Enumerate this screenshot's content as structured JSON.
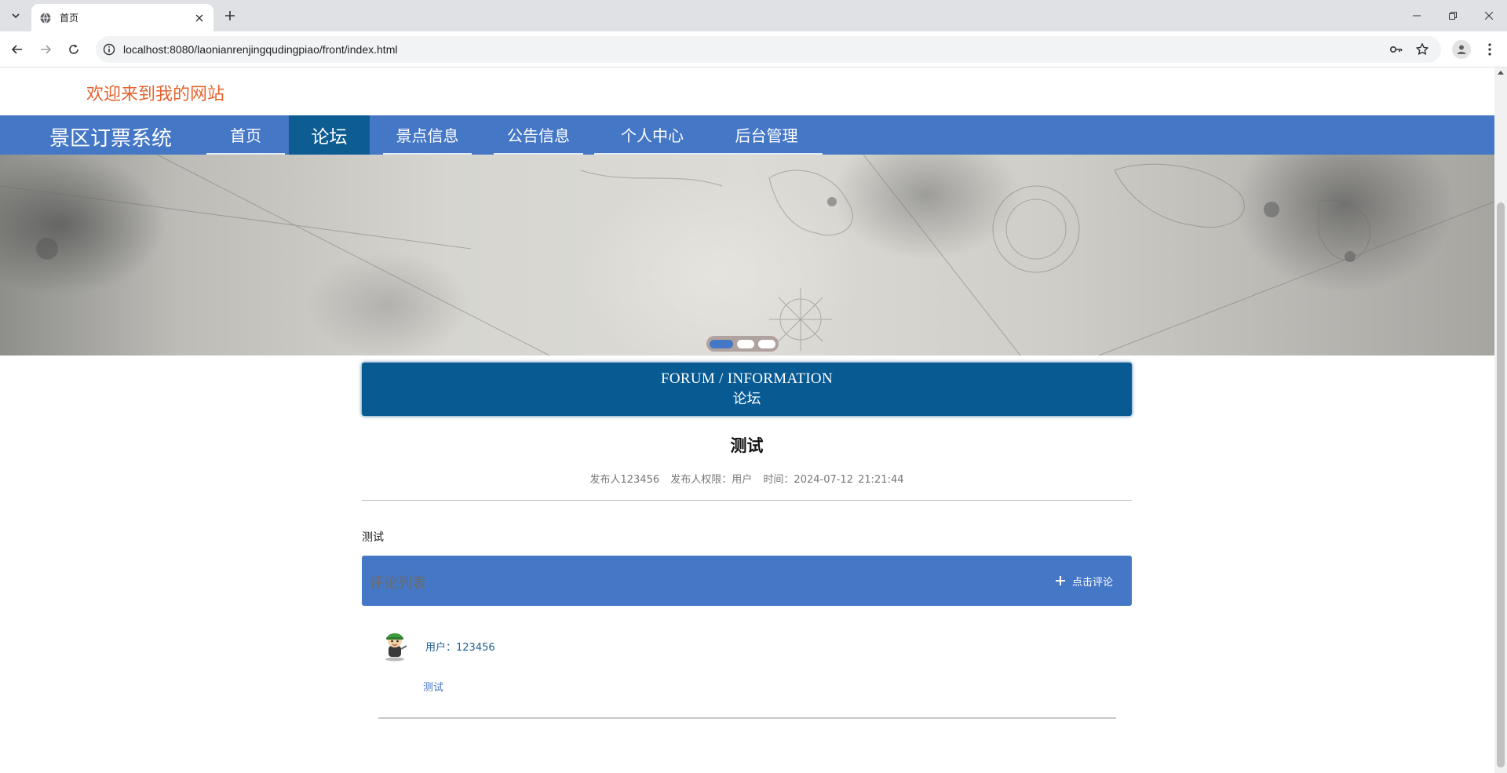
{
  "browser": {
    "tab_title": "首页",
    "url": "localhost:8080/laonianrenjingqudingpiao/front/index.html"
  },
  "site": {
    "welcome": "欢迎来到我的网站",
    "brand": "景区订票系统"
  },
  "nav": {
    "items": [
      {
        "label": "首页"
      },
      {
        "label": "论坛"
      },
      {
        "label": "景点信息"
      },
      {
        "label": "公告信息"
      },
      {
        "label": "个人中心"
      },
      {
        "label": "后台管理"
      }
    ],
    "active_index": 1
  },
  "carousel": {
    "slide_count": 3,
    "active_slide": 0
  },
  "section": {
    "title_en": "FORUM / INFORMATION",
    "title_zh": "论坛"
  },
  "post": {
    "title": "测试",
    "author": "发布人123456",
    "role": "发布人权限：用户",
    "time": "时间：2024-07-12 21:21:44",
    "content": "测试"
  },
  "comments_section": {
    "title": "评论列表",
    "add_button": "点击评论"
  },
  "comments": [
    {
      "user": "用户：123456",
      "text": "测试"
    }
  ],
  "colors": {
    "nav_blue": "#4577c7",
    "active_nav": "#0d5c92",
    "section_blue": "#085a92",
    "welcome_orange": "#e4632e"
  }
}
